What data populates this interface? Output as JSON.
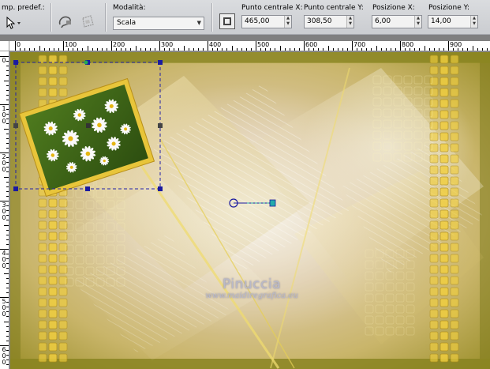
{
  "toolbar": {
    "preset_label": "mp. predef.:",
    "mode_label": "Modalità:",
    "mode_value": "Scala",
    "center_x_label": "Punto centrale X:",
    "center_x_value": "465,00",
    "center_y_label": "Punto centrale Y:",
    "center_y_value": "308,50",
    "pos_x_label": "Posizione X:",
    "pos_x_value": "6,00",
    "pos_y_label": "Posizione Y:",
    "pos_y_value": "14,00",
    "icons": [
      "pointer-dropdown-icon",
      "lasso-icon",
      "transform-icon",
      "position-icon"
    ]
  },
  "ruler_top": [
    "0",
    "100",
    "200",
    "300",
    "400",
    "500",
    "600",
    "700",
    "800",
    "900"
  ],
  "ruler_left": [
    "0",
    "1\n0\n0",
    "2\n0\n0",
    "3\n0\n0",
    "4\n0\n0",
    "5\n0\n0",
    "6\n0\n0",
    "7"
  ],
  "watermark": {
    "title": "Pinuccia",
    "subtitle": "www.maidiregrafica.eu"
  },
  "colors": {
    "selection": "#2222aa",
    "handle": "#1a1aa0",
    "frame_gold": "#e8c53a",
    "pivot_line": "#22aaaa"
  }
}
